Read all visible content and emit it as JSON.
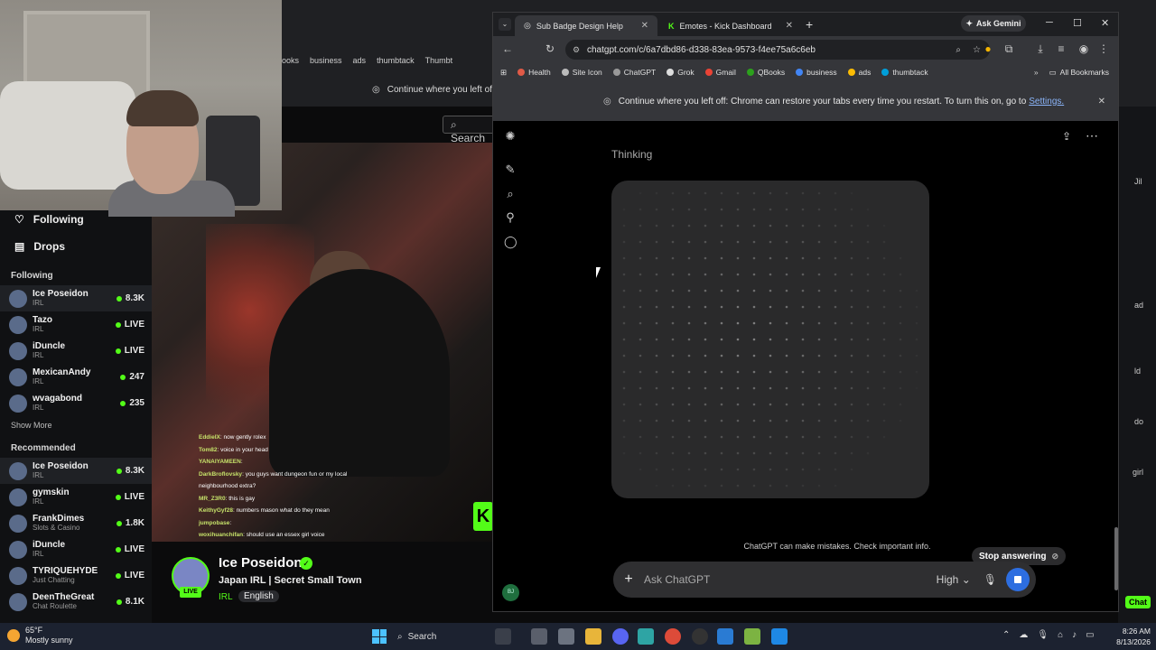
{
  "background_browser": {
    "bookmarks": [
      "ooks",
      "business",
      "ads",
      "thumbtack",
      "Thumbt"
    ],
    "restore_text": "Continue where you left off:",
    "search_placeholder": "Search"
  },
  "kick": {
    "nav": [
      {
        "label": "Following",
        "icon": "heart-icon"
      },
      {
        "label": "Drops",
        "icon": "drops-icon"
      }
    ],
    "following_heading": "Following",
    "following": [
      {
        "name": "Ice Poseidon",
        "category": "IRL",
        "viewers": "8.3K",
        "active": true
      },
      {
        "name": "Tazo",
        "category": "IRL",
        "viewers": "LIVE"
      },
      {
        "name": "iDuncle",
        "category": "IRL",
        "viewers": "LIVE"
      },
      {
        "name": "MexicanAndy",
        "category": "IRL",
        "viewers": "247"
      },
      {
        "name": "wvagabond",
        "category": "IRL",
        "viewers": "235"
      }
    ],
    "show_more": "Show More",
    "recommended_heading": "Recommended",
    "recommended": [
      {
        "name": "Ice Poseidon",
        "category": "IRL",
        "viewers": "8.3K",
        "active": true
      },
      {
        "name": "gymskin",
        "category": "IRL",
        "viewers": "LIVE"
      },
      {
        "name": "FrankDimes",
        "category": "Slots & Casino",
        "viewers": "1.8K"
      },
      {
        "name": "iDuncle",
        "category": "IRL",
        "viewers": "LIVE"
      },
      {
        "name": "TYRIQUEHYDE",
        "category": "Just Chatting",
        "viewers": "LIVE"
      },
      {
        "name": "DeenTheGreat",
        "category": "Chat Roulette",
        "viewers": "8.1K"
      }
    ],
    "chat": [
      {
        "user": "EddieIX",
        "msg": "now gently rolex"
      },
      {
        "user": "Tom82",
        "msg": "voice in your head"
      },
      {
        "user": "YANAIYAMEEN",
        "msg": ""
      },
      {
        "user": "DarkBroflovsky",
        "msg": "you guys want dungeon fun or my local"
      },
      {
        "user": "",
        "msg": "neighbourhood extra?"
      },
      {
        "user": "MR_Z3R0",
        "msg": "this is gay"
      },
      {
        "user": "KeithyGyf28",
        "msg": "numbers mason what do they mean"
      },
      {
        "user": "jumpobase",
        "msg": ""
      },
      {
        "user": "woxihuanchifan",
        "msg": "should use an essex girl voice"
      }
    ],
    "streamer": {
      "name": "Ice Poseidon",
      "live": "LIVE",
      "title": "Japan IRL | Secret Small Town",
      "category": "IRL",
      "language": "English"
    }
  },
  "chrome": {
    "tabs": [
      {
        "title": "Sub Badge Design Help",
        "active": true
      },
      {
        "title": "Emotes - Kick Dashboard",
        "active": false
      }
    ],
    "ask_gemini": "Ask Gemini",
    "url": "chatgpt.com/c/6a7dbd86-d338-83ea-9573-f4ee75a6c6eb",
    "bookmarks": [
      "Health",
      "Site Icon",
      "ChatGPT",
      "Grok",
      "Gmail",
      "QBooks",
      "business",
      "ads",
      "thumbtack"
    ],
    "all_bookmarks": "All Bookmarks",
    "restore_text": "Continue where you left off: Chrome can restore your tabs every time you restart. To turn this on, go to",
    "restore_link": "Settings."
  },
  "chatgpt": {
    "thinking": "Thinking",
    "disclaimer": "ChatGPT can make mistakes. Check important info.",
    "stop_answering": "Stop answering",
    "composer_placeholder": "Ask ChatGPT",
    "model": "High",
    "avatar_initials": "BJ"
  },
  "taskbar": {
    "temperature": "65°F",
    "weather": "Mostly sunny",
    "search": "Search",
    "time": "8:26 AM",
    "date": "8/13/2026"
  },
  "right_strip": {
    "snippets": [
      "Jil",
      "ad",
      "ld",
      "do",
      "girl",
      "Chat"
    ]
  }
}
